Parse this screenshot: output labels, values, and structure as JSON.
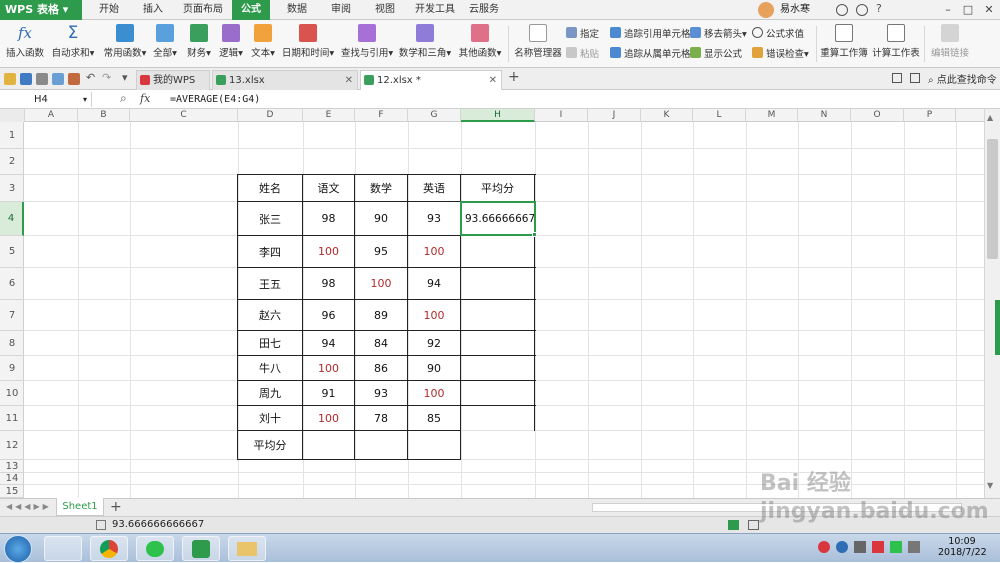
{
  "app": {
    "title": "WPS 表格"
  },
  "menu": [
    "开始",
    "插入",
    "页面布局",
    "公式",
    "数据",
    "审阅",
    "视图",
    "开发工具",
    "云服务"
  ],
  "active_menu": "公式",
  "user": "易水寒",
  "ribbon": {
    "large": [
      "插入函数",
      "自动求和▾",
      "常用函数▾",
      "全部▾",
      "财务▾",
      "逻辑▾",
      "文本▾",
      "日期和时间▾",
      "查找与引用▾",
      "数学和三角▾",
      "其他函数▾",
      "名称管理器"
    ],
    "small_col1": [
      "指定",
      "粘贴"
    ],
    "small_col2": [
      "追踪引用单元格",
      "追踪从属单元格"
    ],
    "small_col3": [
      "移去箭头▾",
      "显示公式"
    ],
    "small_col4": [
      "公式求值",
      "错误检查▾"
    ],
    "right": [
      "重算工作簿",
      "计算工作表",
      "编辑链接"
    ]
  },
  "tabs": {
    "items": [
      "我的WPS",
      "13.xlsx",
      "12.xlsx *"
    ],
    "active": "12.xlsx *",
    "search": "点此查找命令"
  },
  "formula_bar": {
    "name_box": "H4",
    "fx": "fx",
    "formula": "=AVERAGE(E4:G4)"
  },
  "columns": [
    "A",
    "B",
    "C",
    "D",
    "E",
    "F",
    "G",
    "H",
    "I",
    "J",
    "K",
    "L",
    "M",
    "N",
    "O",
    "P"
  ],
  "selected_column": "H",
  "rows": [
    "1",
    "2",
    "3",
    "4",
    "5",
    "6",
    "7",
    "8",
    "9",
    "10",
    "11",
    "12",
    "13",
    "14",
    "15"
  ],
  "selected_row": "4",
  "table": {
    "headers": [
      "姓名",
      "语文",
      "数学",
      "英语",
      "平均分"
    ],
    "rows": [
      {
        "name": "张三",
        "chinese": "98",
        "math": "90",
        "english": "93",
        "avg": "93.66666667"
      },
      {
        "name": "李四",
        "chinese": "100",
        "math": "95",
        "english": "100",
        "avg": ""
      },
      {
        "name": "王五",
        "chinese": "98",
        "math": "100",
        "english": "94",
        "avg": ""
      },
      {
        "name": "赵六",
        "chinese": "96",
        "math": "89",
        "english": "100",
        "avg": ""
      },
      {
        "name": "田七",
        "chinese": "94",
        "math": "84",
        "english": "92",
        "avg": ""
      },
      {
        "name": "牛八",
        "chinese": "100",
        "math": "86",
        "english": "90",
        "avg": ""
      },
      {
        "name": "周九",
        "chinese": "91",
        "math": "93",
        "english": "100",
        "avg": ""
      },
      {
        "name": "刘十",
        "chinese": "100",
        "math": "78",
        "english": "85",
        "avg": ""
      }
    ],
    "footer_label": "平均分",
    "highlight_value": "100",
    "highlight_color": "#b22b2b"
  },
  "sheet": {
    "tab": "Sheet1",
    "add": "+"
  },
  "status": {
    "value": "93.666666666667"
  },
  "taskbar": {
    "time": "10:09",
    "date": "2018/7/22"
  },
  "watermark": "Bai 经验 jingyan.baidu.com",
  "colors": {
    "accent": "#2e9a4b",
    "selection": "#2e9a4b"
  }
}
